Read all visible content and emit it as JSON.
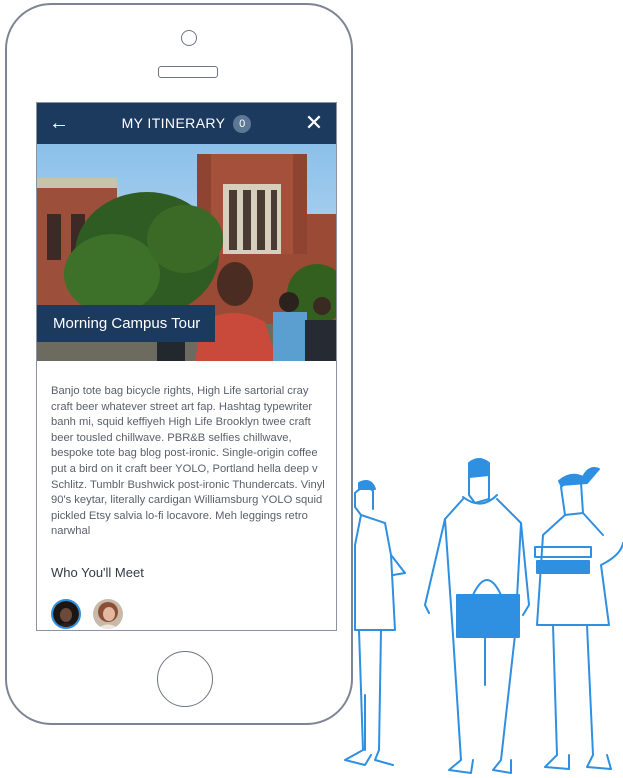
{
  "nav": {
    "title": "MY ITINERARY",
    "count": "0",
    "back_icon": "arrow-left-icon",
    "close_icon": "close-icon"
  },
  "hero": {
    "title": "Morning Campus Tour"
  },
  "description": "Banjo tote bag bicycle rights, High Life sartorial cray craft beer whatever street art fap. Hashtag typewriter banh mi, squid keffiyeh High Life Brooklyn twee craft beer tousled chillwave. PBR&B selfies chillwave, bespoke tote bag blog post-ironic. Single-origin coffee put a bird on it craft beer YOLO, Portland hella deep v Schlitz. Tumblr Bushwick post-ironic Thundercats. Vinyl 90's keytar, literally cardigan Williamsburg YOLO squid pickled Etsy salvia lo-fi locavore. Meh leggings retro narwhal",
  "meet": {
    "title": "Who You'll Meet"
  },
  "colors": {
    "nav_bg": "#1c3a5e",
    "accent": "#2f8fe0",
    "illustration": "#2f8fe0"
  }
}
